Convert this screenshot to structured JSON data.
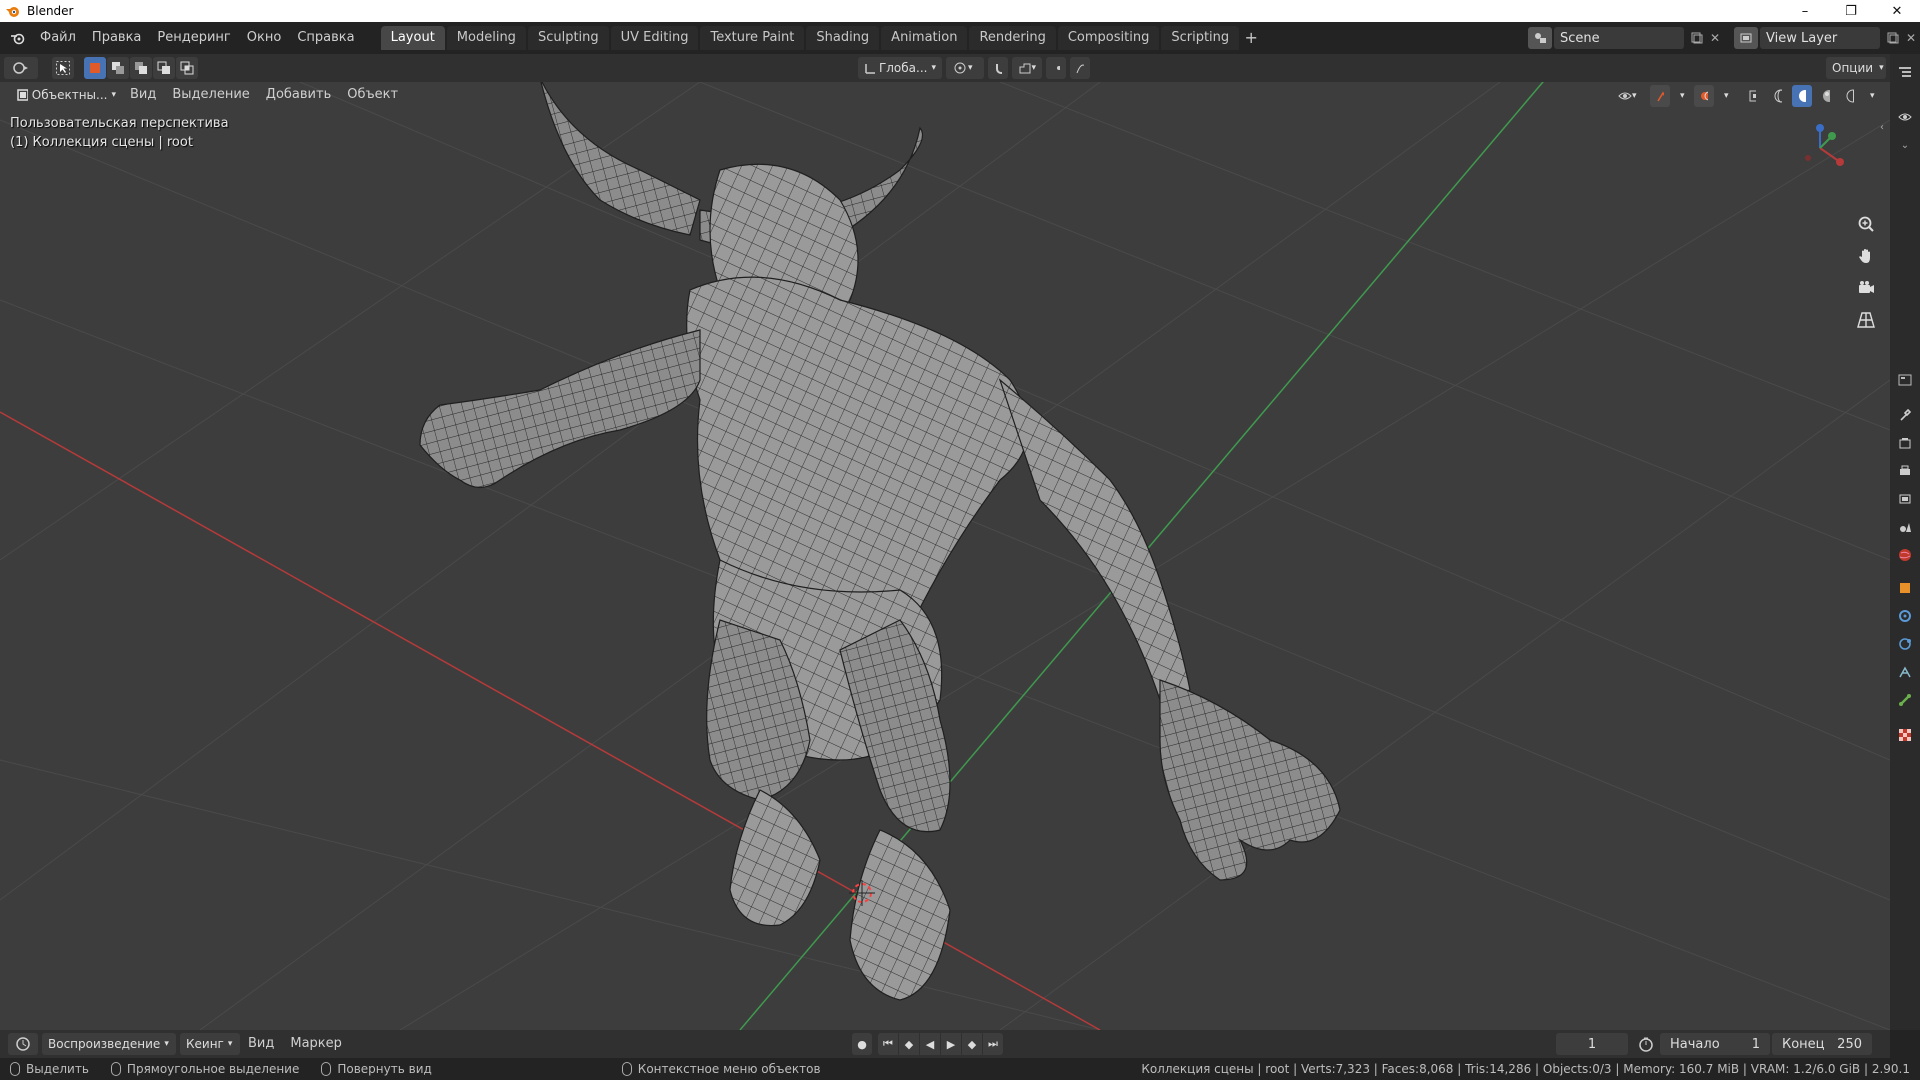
{
  "os": {
    "title": "Blender",
    "minimize": "–",
    "maximize": "❐",
    "close": "✕"
  },
  "menu": [
    "Файл",
    "Правка",
    "Рендеринг",
    "Окно",
    "Справка"
  ],
  "workspaces": [
    "Layout",
    "Modeling",
    "Sculpting",
    "UV Editing",
    "Texture Paint",
    "Shading",
    "Animation",
    "Rendering",
    "Compositing",
    "Scripting"
  ],
  "active_workspace": "Layout",
  "scene": {
    "name": "Scene",
    "view_layer": "View Layer"
  },
  "tool_header": {
    "transform_orientation": "Глоба...",
    "options": "Опции"
  },
  "viewport_header": {
    "mode": "Объектны...",
    "menus": [
      "Вид",
      "Выделение",
      "Добавить",
      "Объект"
    ]
  },
  "viewport_info": {
    "line1": "Пользовательская перспектива",
    "line2": "(1) Коллекция сцены | root"
  },
  "timeline": {
    "playback": "Воспроизведение",
    "keying": "Кеинг",
    "view": "Вид",
    "marker": "Маркер",
    "current_frame": "1",
    "start_label": "Начало",
    "start": "1",
    "end_label": "Конец",
    "end": "250"
  },
  "status": {
    "select": "Выделить",
    "box_select": "Прямоугольное выделение",
    "rotate": "Повернуть вид",
    "context_menu": "Контекстное меню объектов",
    "stats": "Коллекция сцены | root | Verts:7,323 | Faces:8,068 | Tris:14,286 | Objects:0/3 | Memory: 160.7 MiB | VRAM: 1.2/6.0 GiB | 2.90.1"
  },
  "colors": {
    "accent": "#4772b3",
    "x_axis": "#b63a3a",
    "y_axis": "#3f9a4e",
    "z_axis": "#3a6ec6",
    "viewport_bg": "#3d3d3d"
  }
}
